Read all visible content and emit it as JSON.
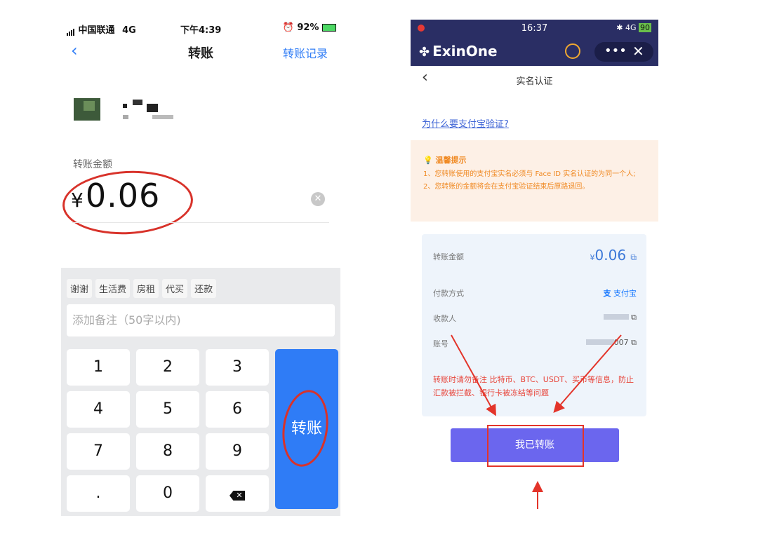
{
  "left": {
    "status": {
      "carrier": "中国联通",
      "network": "4G",
      "time": "下午4:39",
      "battery": "92%"
    },
    "nav": {
      "title": "转账",
      "records": "转账记录"
    },
    "amount_label": "转账金额",
    "amount_currency": "¥",
    "amount": "0.06",
    "chips": [
      "谢谢",
      "生活费",
      "房租",
      "代买",
      "还款"
    ],
    "memo_placeholder": "添加备注（50字以内)",
    "keys": [
      "1",
      "2",
      "3",
      "4",
      "5",
      "6",
      "7",
      "8",
      "9",
      ".",
      "0"
    ],
    "transfer_key": "转账"
  },
  "right": {
    "status": {
      "time": "16:37",
      "network": "4G",
      "battery": "90"
    },
    "brand": "ExinOne",
    "nav_title": "实名认证",
    "why_link": "为什么要支付宝验证?",
    "tip": {
      "title": "温馨提示",
      "line1": "1、您转账使用的支付宝实名必须与 Face ID 实名认证的为同一个人;",
      "line2": "2、您转账的金额将会在支付宝验证结束后原路退回。"
    },
    "card": {
      "amount_label": "转账金额",
      "amount_currency": "¥",
      "amount": "0.06",
      "method_label": "付款方式",
      "method_value": "支付宝",
      "payee_label": "收款人",
      "account_label": "账号",
      "account_suffix": "007",
      "warning": "转账时请勿备注 比特币、BTC、USDT、买币等信息，防止汇款被拦截、银行卡被冻结等问题"
    },
    "cta": "我已转账"
  },
  "colors": {
    "accent_blue": "#2f7cf6",
    "exin_header": "#2a2e64",
    "cta_purple": "#6b66ee",
    "annotation_red": "#d8322a"
  }
}
